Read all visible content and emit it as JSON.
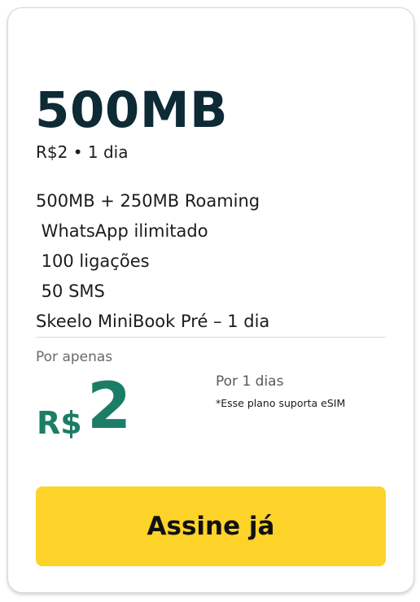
{
  "plan": {
    "title": "500MB",
    "subtitle": "R$2 • 1 dia",
    "features": [
      "500MB + 250MB Roaming",
      " WhatsApp ilimitado",
      " 100 ligações",
      " 50 SMS",
      "Skeelo MiniBook Pré – 1 dia"
    ]
  },
  "pricing": {
    "prefix": "Por apenas",
    "currency": "R$",
    "amount": "2",
    "period": "Por 1 dias",
    "note": "*Esse plano suporta eSIM"
  },
  "cta": {
    "label": "Assine já"
  },
  "colors": {
    "title": "#0d2a35",
    "price": "#1c7d67",
    "cta_background": "#fdd32a"
  }
}
